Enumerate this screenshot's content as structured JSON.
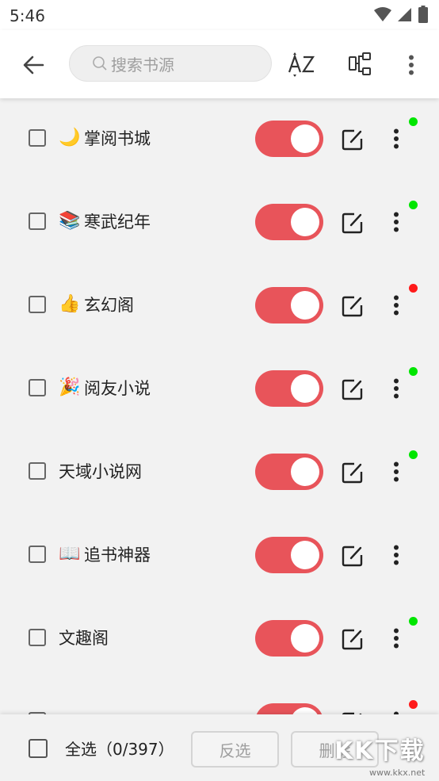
{
  "status_bar": {
    "time": "5:46"
  },
  "header": {
    "search_placeholder": "搜索书源"
  },
  "accent_color": "#e8545a",
  "sources": [
    {
      "emoji": "🌙",
      "name": "掌阅书城",
      "enabled": true,
      "dot": "#00e600"
    },
    {
      "emoji": "📚",
      "name": "寒武纪年",
      "enabled": true,
      "dot": "#00e600"
    },
    {
      "emoji": "👍",
      "name": "玄幻阁",
      "enabled": true,
      "dot": "#ff1a1a"
    },
    {
      "emoji": "🎉",
      "name": "阅友小说",
      "enabled": true,
      "dot": "#00e600"
    },
    {
      "emoji": "",
      "name": "天域小说网",
      "enabled": true,
      "dot": "#00e600"
    },
    {
      "emoji": "📖",
      "name": "追书神器",
      "enabled": true,
      "dot": ""
    },
    {
      "emoji": "",
      "name": "文趣阁",
      "enabled": true,
      "dot": "#00e600"
    },
    {
      "emoji": "",
      "name": "",
      "enabled": true,
      "dot": "#ff1a1a"
    }
  ],
  "bottom_bar": {
    "select_all_label": "全选（0/397）",
    "invert_label": "反选",
    "delete_label": "删除"
  },
  "watermark": {
    "text": "KK下载",
    "url": "www.kkx.net"
  }
}
